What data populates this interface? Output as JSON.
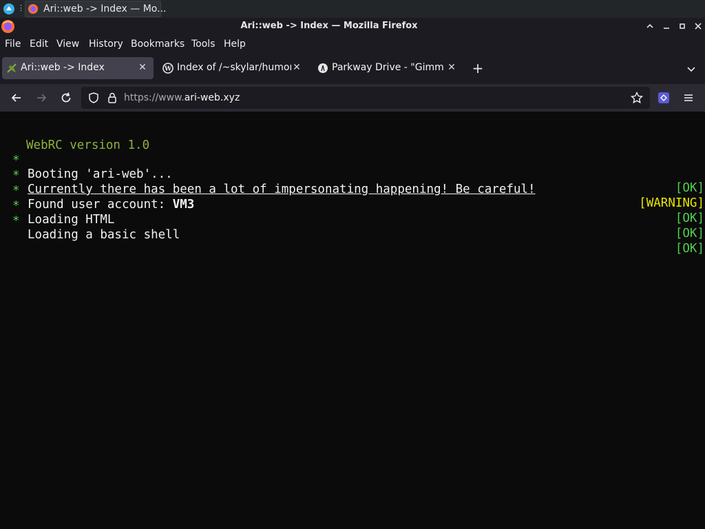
{
  "taskbar": {
    "task_title": "Ari::web -> Index — Mo..."
  },
  "window": {
    "title": "Ari::web -> Index — Mozilla Firefox",
    "controls": [
      "chevron-up-icon",
      "minimize-icon",
      "maximize-icon",
      "close-icon"
    ]
  },
  "menu": {
    "items": [
      {
        "label": "File",
        "icon": "none"
      },
      {
        "label": "Edit",
        "icon": "none"
      },
      {
        "label": "View",
        "icon": "none"
      },
      {
        "label": "History",
        "icon": "none"
      },
      {
        "label": "Bookmarks",
        "icon": "none"
      },
      {
        "label": "Tools",
        "icon": "none"
      },
      {
        "label": "Help",
        "icon": "none"
      }
    ]
  },
  "tabs": [
    {
      "label": "Ari::web -> Index",
      "active": true,
      "icon": "leaf-favicon"
    },
    {
      "label": "Index of /~skylar/humor/",
      "active": false,
      "icon": "wordpress-favicon"
    },
    {
      "label": "Parkway Drive - \"Gimme",
      "active": false,
      "icon": "generic-favicon"
    }
  ],
  "nav": {
    "url_prefix": "https://www.",
    "url_domain": "ari-web.xyz"
  },
  "terminal": {
    "version": "WebRC version 1.0",
    "lines": [
      {
        "bullet": "*",
        "parts": [
          "Booting 'ari-web'..."
        ],
        "status": "[OK]"
      },
      {
        "bullet": "*",
        "parts": [
          "Currently there has been a lot of impersonating happening! Be careful!"
        ],
        "status": "[WARNING]"
      },
      {
        "bullet": "*",
        "parts": [
          "Found user account: ",
          "VM3"
        ],
        "status": "[OK]"
      },
      {
        "bullet": "*",
        "parts": [
          "Loading HTML"
        ],
        "status": "[OK]"
      },
      {
        "bullet": "*",
        "parts": [
          "Loading a basic shell"
        ],
        "status": "[OK]"
      }
    ]
  },
  "colors": {
    "background": "#0b0b0b",
    "ok": "#4fd04f",
    "warning": "#e6e600",
    "version": "#8cb23c",
    "chrome": "#1c1b22",
    "navbar": "#2b2a33"
  }
}
